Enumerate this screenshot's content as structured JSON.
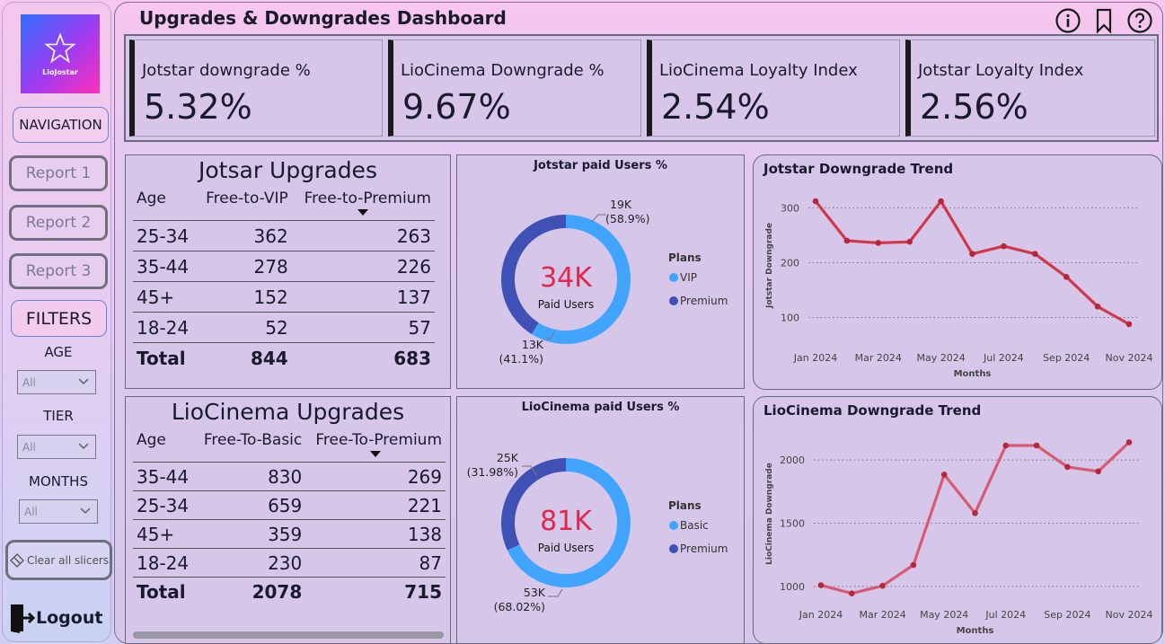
{
  "sidebar": {
    "logo_text": "LioJostar",
    "nav_label": "NAVIGATION",
    "reports": [
      "Report 1",
      "Report 2",
      "Report 3"
    ],
    "filters_label": "FILTERS",
    "filters": [
      {
        "label": "AGE",
        "value": "All"
      },
      {
        "label": "TIER",
        "value": "All"
      },
      {
        "label": "MONTHS",
        "value": "All"
      }
    ],
    "clear_label": "Clear all slicers",
    "logout_label": "Logout"
  },
  "header": {
    "title": "Upgrades & Downgrades Dashboard"
  },
  "kpis": [
    {
      "label": "Jotstar downgrade %",
      "value": "5.32%"
    },
    {
      "label": "LioCinema Downgrade %",
      "value": "9.67%"
    },
    {
      "label": "LioCinema Loyalty Index",
      "value": "2.54%"
    },
    {
      "label": "Jotstar Loyalty Index",
      "value": "2.56%"
    }
  ],
  "jotstar_upgrades": {
    "title": "Jotsar Upgrades",
    "headers": [
      "Age",
      "Free-to-VIP",
      "Free-to-Premium"
    ],
    "rows": [
      [
        "25-34",
        "362",
        "263"
      ],
      [
        "35-44",
        "278",
        "226"
      ],
      [
        "45+",
        "152",
        "137"
      ],
      [
        "18-24",
        "52",
        "57"
      ]
    ],
    "total": [
      "Total",
      "844",
      "683"
    ]
  },
  "liocinema_upgrades": {
    "title": "LioCinema Upgrades",
    "headers": [
      "Age",
      "Free-To-Basic",
      "Free-To-Premium"
    ],
    "rows": [
      [
        "35-44",
        "830",
        "269"
      ],
      [
        "25-34",
        "659",
        "221"
      ],
      [
        "45+",
        "359",
        "138"
      ],
      [
        "18-24",
        "230",
        "87"
      ]
    ],
    "total": [
      "Total",
      "2078",
      "715"
    ]
  },
  "chart_data": [
    {
      "type": "pie",
      "title": "Jotstar paid Users %",
      "center_value": "34K",
      "center_label": "Paid Users",
      "legend_title": "Plans",
      "slices": [
        {
          "name": "VIP",
          "label": "19K",
          "pct_label": "(58.9%)",
          "value": 58.9,
          "color": "#41a5ff"
        },
        {
          "name": "Premium",
          "label": "13K",
          "pct_label": "(41.1%)",
          "value": 41.1,
          "color": "#3f51b5"
        }
      ]
    },
    {
      "type": "pie",
      "title": "LioCinema paid Users %",
      "center_value": "81K",
      "center_label": "Paid Users",
      "legend_title": "Plans",
      "slices": [
        {
          "name": "Basic",
          "label": "53K",
          "pct_label": "(68.02%)",
          "value": 68.02,
          "color": "#41a5ff"
        },
        {
          "name": "Premium",
          "label": "25K",
          "pct_label": "(31.98%)",
          "value": 31.98,
          "color": "#3f51b5"
        }
      ]
    },
    {
      "type": "line",
      "title": "Jotstar Downgrade Trend",
      "xlabel": "Months",
      "ylabel": "Jotstar Downgrade",
      "x": [
        "Jan 2024",
        "Feb 2024",
        "Mar 2024",
        "Apr 2024",
        "May 2024",
        "Jun 2024",
        "Jul 2024",
        "Aug 2024",
        "Sep 2024",
        "Oct 2024",
        "Nov 2024"
      ],
      "x_tick_labels": [
        "Jan 2024",
        "Mar 2024",
        "May 2024",
        "Jul 2024",
        "Sep 2024",
        "Nov 2024"
      ],
      "y_ticks": [
        100,
        200,
        300
      ],
      "ylim": [
        60,
        330
      ],
      "values": [
        312,
        240,
        236,
        238,
        312,
        216,
        230,
        216,
        174,
        120,
        88
      ],
      "color": "#d1394a",
      "grid": true
    },
    {
      "type": "line",
      "title": "LioCinema Downgrade Trend",
      "xlabel": "Months",
      "ylabel": "LioCinema Downgrade",
      "x": [
        "Jan 2024",
        "Feb 2024",
        "Mar 2024",
        "Apr 2024",
        "May 2024",
        "Jun 2024",
        "Jul 2024",
        "Aug 2024",
        "Sep 2024",
        "Oct 2024",
        "Nov 2024"
      ],
      "x_tick_labels": [
        "Jan 2024",
        "Mar 2024",
        "May 2024",
        "Jul 2024",
        "Sep 2024",
        "Nov 2024"
      ],
      "y_ticks": [
        1000,
        1500,
        2000
      ],
      "ylim": [
        900,
        2250
      ],
      "values": [
        1010,
        945,
        1005,
        1170,
        1885,
        1580,
        2115,
        2115,
        1945,
        1910,
        2140
      ],
      "color": "#d65a72",
      "grid": true
    }
  ]
}
